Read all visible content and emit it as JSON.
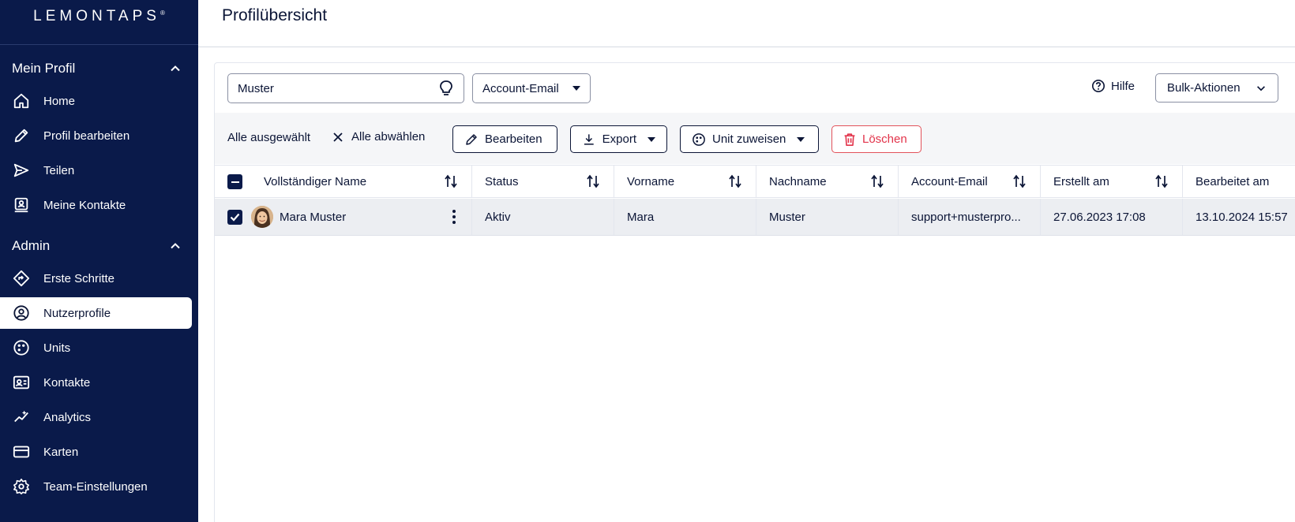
{
  "brand": {
    "name": "LEMONTAPS",
    "mark": "®"
  },
  "sidebar": {
    "sections": [
      {
        "title": "Mein Profil",
        "items": [
          {
            "label": "Home",
            "icon": "home-icon"
          },
          {
            "label": "Profil bearbeiten",
            "icon": "pencil-icon"
          },
          {
            "label": "Teilen",
            "icon": "send-icon"
          },
          {
            "label": "Meine Kontakte",
            "icon": "contacts-icon"
          }
        ]
      },
      {
        "title": "Admin",
        "items": [
          {
            "label": "Erste Schritte",
            "icon": "route-icon"
          },
          {
            "label": "Nutzerprofile",
            "icon": "user-circle-icon",
            "active": true
          },
          {
            "label": "Units",
            "icon": "palette-icon"
          },
          {
            "label": "Kontakte",
            "icon": "contact-card-icon"
          },
          {
            "label": "Analytics",
            "icon": "analytics-icon"
          },
          {
            "label": "Karten",
            "icon": "card-icon"
          },
          {
            "label": "Team-Einstellungen",
            "icon": "gear-icon"
          }
        ]
      }
    ]
  },
  "header": {
    "title": "Profilübersicht"
  },
  "filters": {
    "search_value": "Muster",
    "field_select": "Account-Email",
    "help_label": "Hilfe",
    "bulk_label": "Bulk-Aktionen"
  },
  "toolbar": {
    "all_selected": "Alle ausgewählt",
    "deselect_all": "Alle abwählen",
    "edit": "Bearbeiten",
    "export": "Export",
    "assign_unit": "Unit zuweisen",
    "delete": "Löschen"
  },
  "table": {
    "columns": [
      "Vollständiger Name",
      "Status",
      "Vorname",
      "Nachname",
      "Account-Email",
      "Erstellt am",
      "Bearbeitet am"
    ],
    "rows": [
      {
        "name": "Mara Muster",
        "status": "Aktiv",
        "first": "Mara",
        "last": "Muster",
        "email": "support+musterpro...",
        "created": "27.06.2023 17:08",
        "edited": "13.10.2024 15:57"
      }
    ]
  },
  "colors": {
    "sidebar_bg": "#0a1a4a",
    "danger": "#e2334a"
  }
}
